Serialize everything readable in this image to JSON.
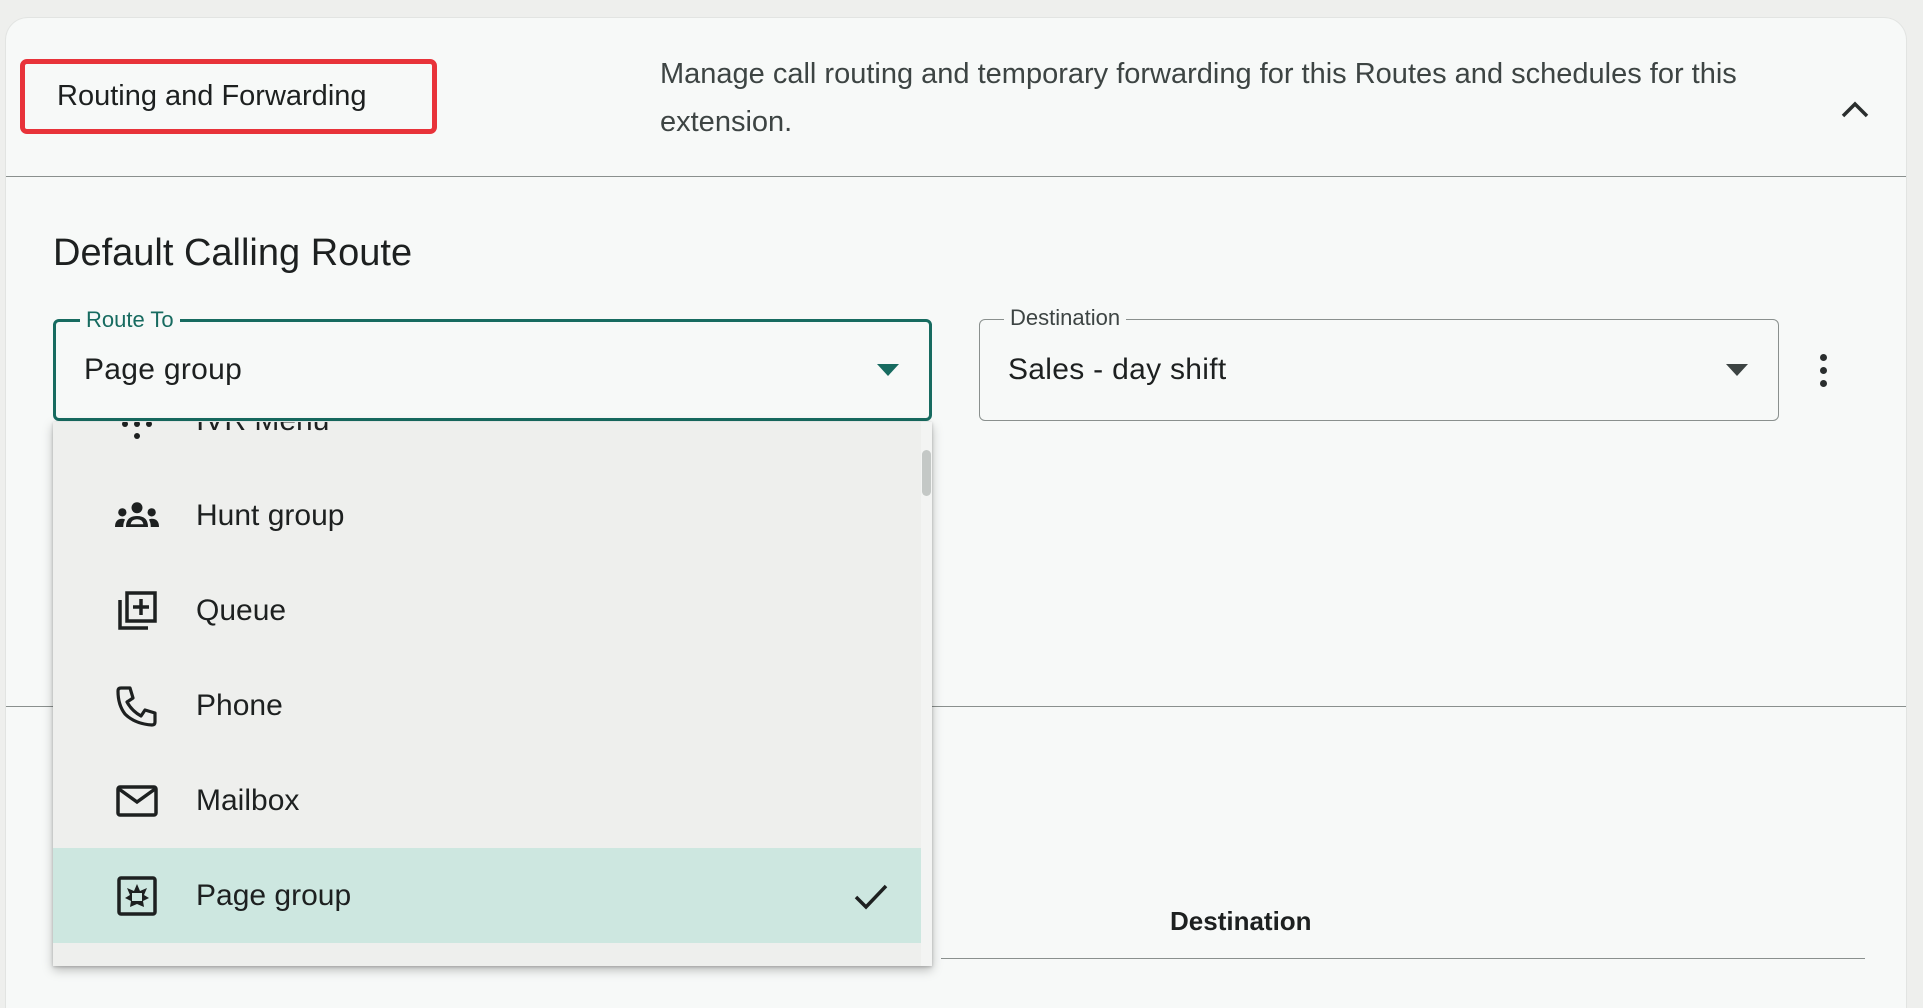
{
  "header": {
    "title": "Routing and Forwarding",
    "description": "Manage call routing and temporary forwarding for this Routes and schedules for this extension.",
    "collapse_icon": "chevron-up-icon"
  },
  "section": {
    "title": "Default Calling Route"
  },
  "route_to": {
    "label": "Route To",
    "value": "Page group"
  },
  "destination": {
    "label": "Destination",
    "value": "Sales - day shift"
  },
  "more_icon": "kebab-menu-icon",
  "table": {
    "column_destination": "Destination"
  },
  "menu": {
    "items": [
      {
        "label": "IVR Menu",
        "icon": "dialpad-icon"
      },
      {
        "label": "Hunt group",
        "icon": "groups-icon"
      },
      {
        "label": "Queue",
        "icon": "library-add-icon"
      },
      {
        "label": "Phone",
        "icon": "phone-icon"
      },
      {
        "label": "Mailbox",
        "icon": "mail-icon"
      },
      {
        "label": "Page group",
        "icon": "page-group-icon",
        "selected": true
      }
    ]
  },
  "colors": {
    "accent": "#176b60",
    "selected_bg": "#cde7e0",
    "highlight_border": "#e8333a"
  }
}
